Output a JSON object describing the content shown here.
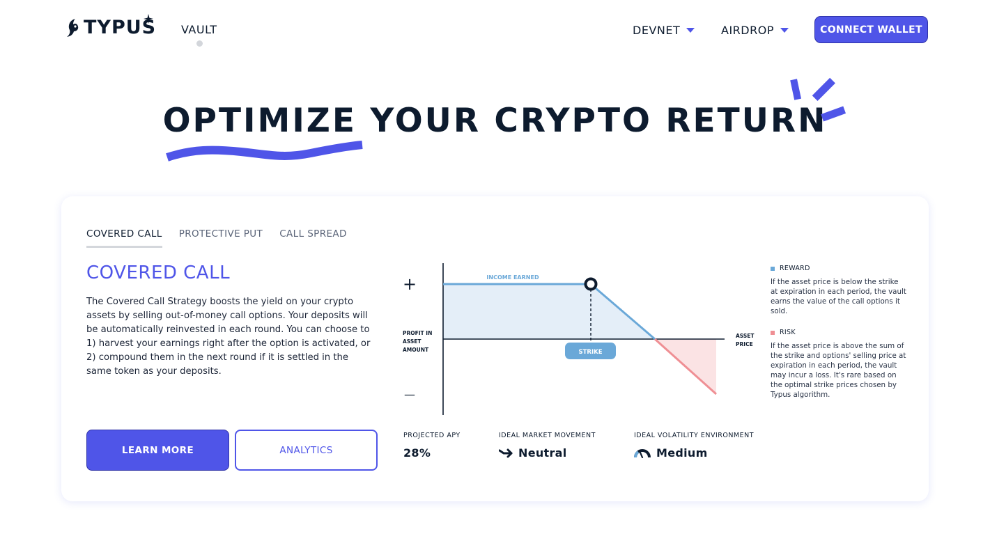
{
  "header": {
    "logo_text": "TYPUS",
    "nav": {
      "vault": "VAULT",
      "network": "DEVNET",
      "airdrop": "AIRDROP"
    },
    "connect_label": "CONNECT WALLET"
  },
  "hero": {
    "title": "OPTIMIZE YOUR CRYPTO RETURN"
  },
  "card": {
    "tabs": [
      {
        "label": "COVERED CALL",
        "active": true
      },
      {
        "label": "PROTECTIVE PUT",
        "active": false
      },
      {
        "label": "CALL SPREAD",
        "active": false
      }
    ],
    "strategy_title": "COVERED CALL",
    "description": "The Covered Call Strategy boosts the yield on your crypto assets by selling out-of-money call options. Your deposits will be automatically reinvested in each round. You can choose to 1) harvest your earnings right after the option is activated, or 2) compound them in the next round if it is settled in the same token as your deposits.",
    "buttons": {
      "learn_more": "LEARN MORE",
      "analytics": "ANALYTICS"
    },
    "chart": {
      "plus": "+",
      "minus": "—",
      "y_label": [
        "PROFIT IN",
        "ASSET",
        "AMOUNT"
      ],
      "x_label": [
        "ASSET",
        "PRICE"
      ],
      "income_label": "INCOME EARNED",
      "strike_label": "STRIKE"
    },
    "legend": {
      "reward_title": "REWARD",
      "reward_text": "If the asset price is below the strike at expiration in each period, the vault earns the value of the call options it sold.",
      "risk_title": "RISK",
      "risk_text": "If the asset price is above the sum of the strike and options' selling price at expiration in each period, the vault may incur a loss. It's rare based on the optimal strike prices chosen by Typus algorithm."
    },
    "stats": {
      "apy_label": "PROJECTED APY",
      "apy_value": "28%",
      "movement_label": "IDEAL MARKET MOVEMENT",
      "movement_value": "Neutral",
      "volatility_label": "IDEAL VOLATILITY ENVIRONMENT",
      "volatility_value": "Medium"
    }
  },
  "colors": {
    "accent": "#4f55e8",
    "reward": "#6aa8d8",
    "risk": "#ef8f94",
    "dark": "#0d1b2e"
  }
}
